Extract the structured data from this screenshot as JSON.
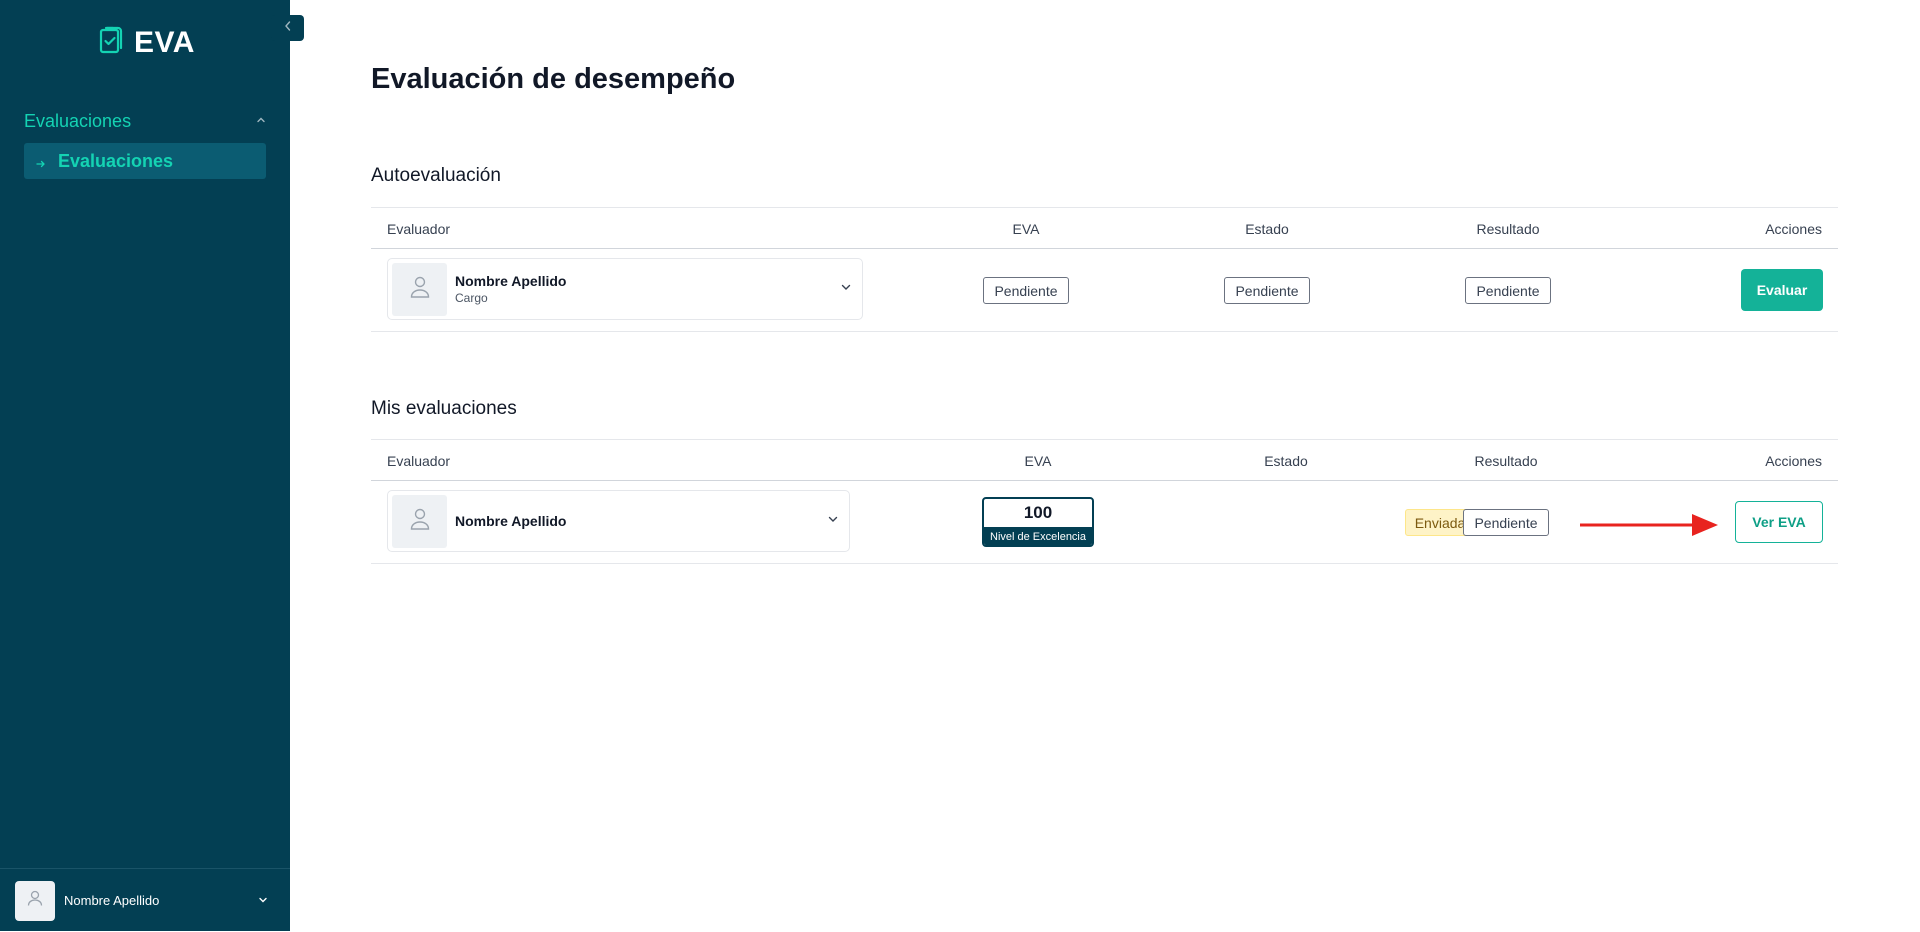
{
  "app": {
    "name": "EVA"
  },
  "sidebar": {
    "group_label": "Evaluaciones",
    "items": [
      {
        "label": "Evaluaciones"
      }
    ],
    "user_name": "Nombre Apellido"
  },
  "page": {
    "title": "Evaluación de desempeño"
  },
  "self_evaluation": {
    "title": "Autoevaluación",
    "columns": [
      "Evaluador",
      "EVA",
      "Estado",
      "Resultado",
      "Acciones"
    ],
    "row": {
      "evaluator_name": "Nombre Apellido",
      "evaluator_role": "Cargo",
      "eva": "Pendiente",
      "status": "Pendiente",
      "result": "Pendiente",
      "action": "Evaluar"
    }
  },
  "my_evaluations": {
    "title": "Mis evaluaciones",
    "columns": [
      "Evaluador",
      "EVA",
      "Estado",
      "Resultado",
      "Acciones"
    ],
    "row": {
      "evaluator_name": "Nombre Apellido",
      "eva_score": "100",
      "eva_level": "Nivel de Excelencia",
      "status": "Enviada",
      "result": "Pendiente",
      "action": "Ver EVA"
    }
  },
  "colors": {
    "sidebar_bg": "#033f53",
    "accent": "#14d3b3",
    "primary_button": "#14b298",
    "status_sent_bg": "#fef3c7",
    "annotation_arrow": "#e8231f"
  },
  "icons": [
    "clipboard-check-icon",
    "chevron-left-icon",
    "chevron-up-icon",
    "arrow-right-icon",
    "user-icon",
    "chevron-down-icon"
  ]
}
